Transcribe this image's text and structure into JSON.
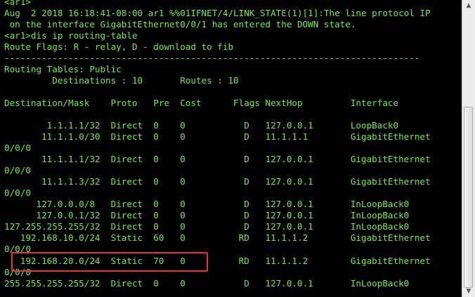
{
  "terminal": {
    "lines": [
      "<ar1>",
      "Aug  2 2018 16:18:41-08:00 ar1 %%01IFNET/4/LINK_STATE(1)[1]:The line protocol IP",
      " on the interface GigabitEthernet0/0/1 has entered the DOWN state.",
      "<ar1>dis ip routing-table",
      "Route Flags: R - relay, D - download to fib",
      "------------------------------------------------------------------------------",
      "Routing Tables: Public",
      "         Destinations : 10       Routes : 10",
      "",
      "Destination/Mask    Proto   Pre  Cost      Flags NextHop         Interface",
      "",
      "        1.1.1.1/32  Direct  0    0           D   127.0.0.1       LoopBack0",
      "       11.1.1.0/30  Direct  0    0           D   11.1.1.1        GigabitEthernet",
      "0/0/0",
      "       11.1.1.1/32  Direct  0    0           D   127.0.0.1       GigabitEthernet",
      "0/0/0",
      "       11.1.1.3/32  Direct  0    0           D   127.0.0.1       GigabitEthernet",
      "0/0/0",
      "      127.0.0.0/8   Direct  0    0           D   127.0.0.1       InLoopBack0",
      "      127.0.0.1/32  Direct  0    0           D   127.0.0.1       InLoopBack0",
      "127.255.255.255/32  Direct  0    0           D   127.0.0.1       InLoopBack0",
      "   192.168.10.0/24  Static  60   0          RD   11.1.1.2        GigabitEthernet",
      "0/0/0",
      "",
      "   192.168.20.0/24  Static  70   0          RD   11.1.1.2        GigabitEthernet",
      "0/0/0",
      "255.255.255.255/32  Direct  0    0           D   127.0.0.1       InLoopBack0"
    ]
  },
  "colors": {
    "text": "#79e84b",
    "background": "#000000",
    "highlight_border": "#e8323a"
  },
  "scrollbar": {
    "up_icon": "scroll-up-arrow",
    "down_icon": "scroll-down-arrow"
  }
}
